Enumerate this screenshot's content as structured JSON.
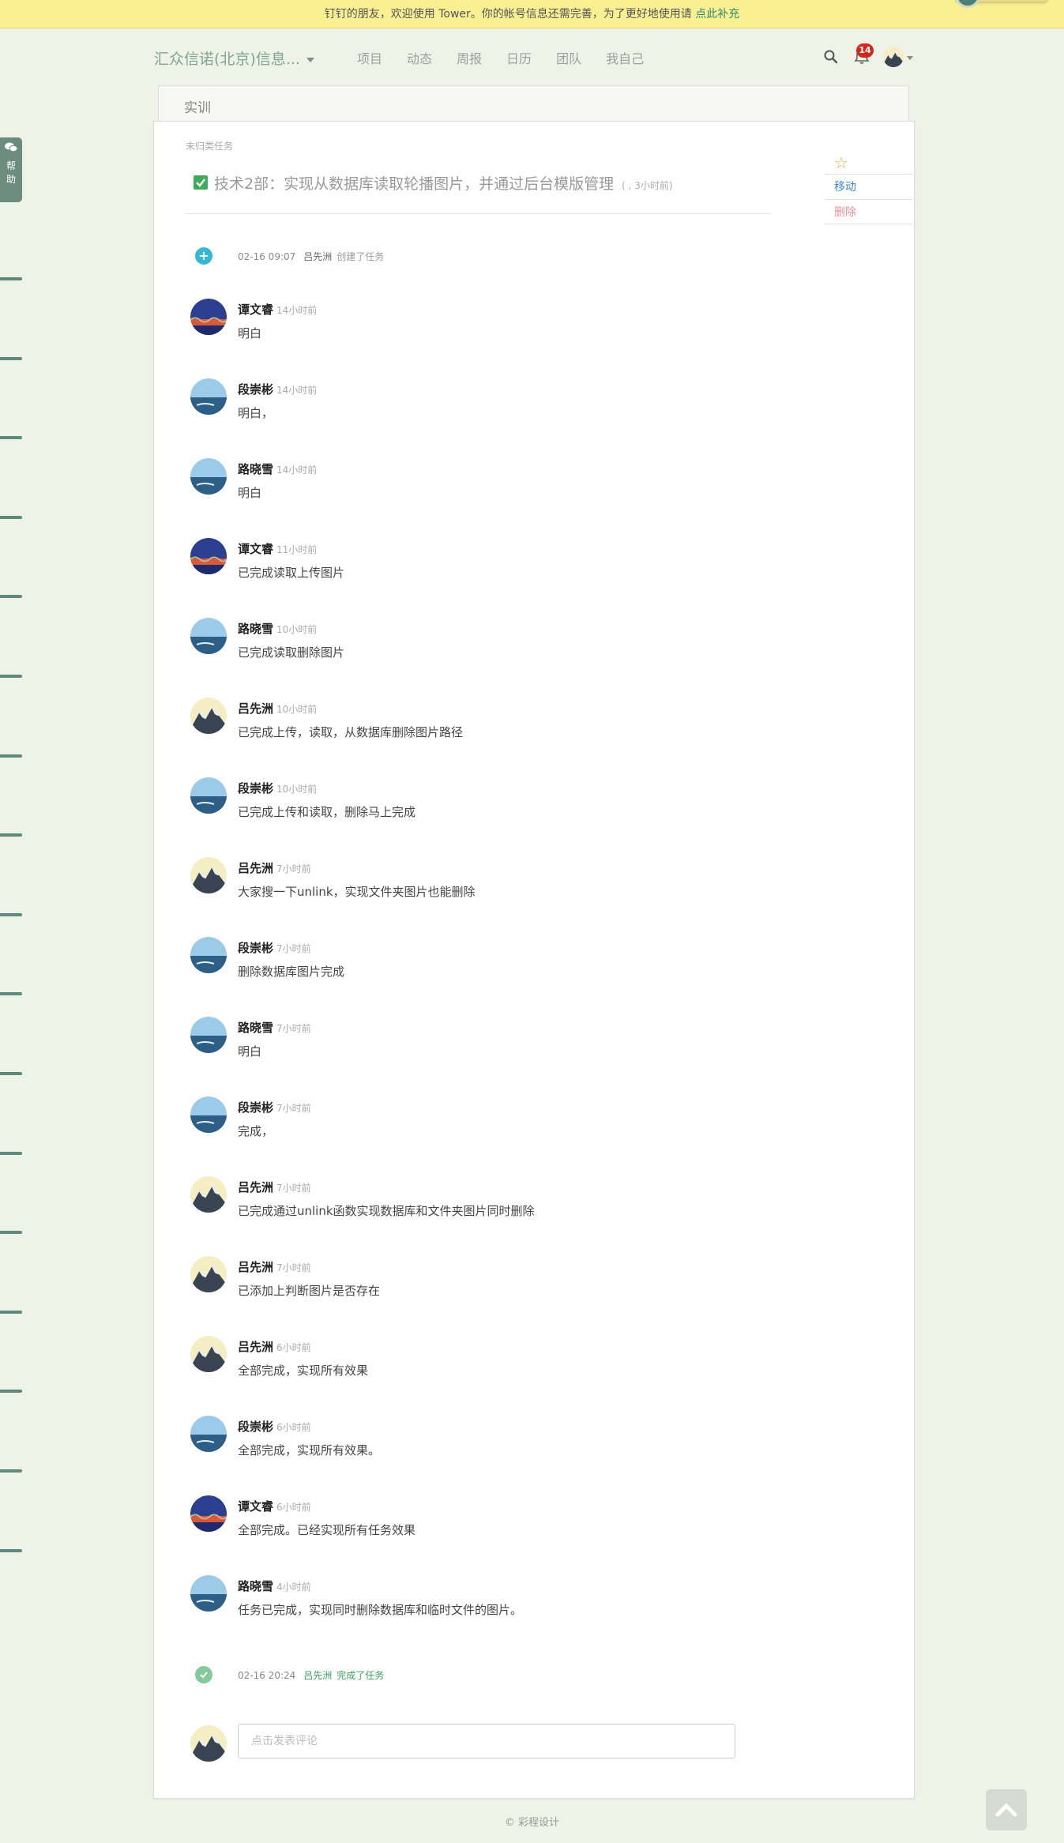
{
  "notice": {
    "text": "钉钉的朋友，欢迎使用 Tower。你的帐号信息还需完善，为了更好地使用请 ",
    "link": "点此补充"
  },
  "nav": {
    "brand": "汇众信诺(北京)信息...",
    "links": [
      "项目",
      "动态",
      "周报",
      "日历",
      "团队",
      "我自己"
    ],
    "notification_count": "14"
  },
  "help": {
    "label": "帮助"
  },
  "project": {
    "tab": "实训"
  },
  "task": {
    "breadcrumb": "未归类任务",
    "title": "技术2部：实现从数据库读取轮播图片，并通过后台模版管理",
    "meta": "(          , 3小时前)"
  },
  "actions": {
    "move": "移动",
    "delete": "删除"
  },
  "created_event": {
    "when": "02-16 09:07",
    "who": "吕先洲",
    "what": "创建了任务"
  },
  "comments": [
    {
      "name": "谭文睿",
      "time": "14小时前",
      "text": "明白",
      "avatar": "red"
    },
    {
      "name": "段崇彬",
      "time": "14小时前",
      "text": "明白，",
      "avatar": "sea"
    },
    {
      "name": "路晓雪",
      "time": "14小时前",
      "text": "明白",
      "avatar": "sea"
    },
    {
      "name": "谭文睿",
      "time": "11小时前",
      "text": "已完成读取上传图片",
      "avatar": "red"
    },
    {
      "name": "路晓雪",
      "time": "10小时前",
      "text": "已完成读取删除图片",
      "avatar": "sea"
    },
    {
      "name": "吕先洲",
      "time": "10小时前",
      "text": "已完成上传，读取，从数据库删除图片路径",
      "avatar": "mtn"
    },
    {
      "name": "段崇彬",
      "time": "10小时前",
      "text": "已完成上传和读取，删除马上完成",
      "avatar": "sea"
    },
    {
      "name": "吕先洲",
      "time": "7小时前",
      "text": "大家搜一下unlink，实现文件夹图片也能删除",
      "avatar": "mtn"
    },
    {
      "name": "段崇彬",
      "time": "7小时前",
      "text": "删除数据库图片完成",
      "avatar": "sea"
    },
    {
      "name": "路晓雪",
      "time": "7小时前",
      "text": "明白",
      "avatar": "sea"
    },
    {
      "name": "段崇彬",
      "time": "7小时前",
      "text": "完成，",
      "avatar": "sea"
    },
    {
      "name": "吕先洲",
      "time": "7小时前",
      "text": "已完成通过unlink函数实现数据库和文件夹图片同时删除",
      "avatar": "mtn"
    },
    {
      "name": "吕先洲",
      "time": "7小时前",
      "text": "已添加上判断图片是否存在",
      "avatar": "mtn"
    },
    {
      "name": "吕先洲",
      "time": "6小时前",
      "text": "全部完成，实现所有效果",
      "avatar": "mtn"
    },
    {
      "name": "段崇彬",
      "time": "6小时前",
      "text": "全部完成，实现所有效果。",
      "avatar": "sea"
    },
    {
      "name": "谭文睿",
      "time": "6小时前",
      "text": "全部完成。已经实现所有任务效果",
      "avatar": "red"
    },
    {
      "name": "路晓雪",
      "time": "4小时前",
      "text": "任务已完成，实现同时删除数据库和临时文件的图片。",
      "avatar": "sea"
    }
  ],
  "completed_event": {
    "when": "02-16 20:24",
    "who": "吕先洲",
    "what": "完成了任务"
  },
  "comment_box": {
    "placeholder": "点击发表评论"
  },
  "footer": {
    "text": "© 彩程设计"
  },
  "colors": {
    "accent": "#7da696",
    "success": "#3c9e5e",
    "create": "#38b6d6",
    "badge": "#d02a1e"
  }
}
